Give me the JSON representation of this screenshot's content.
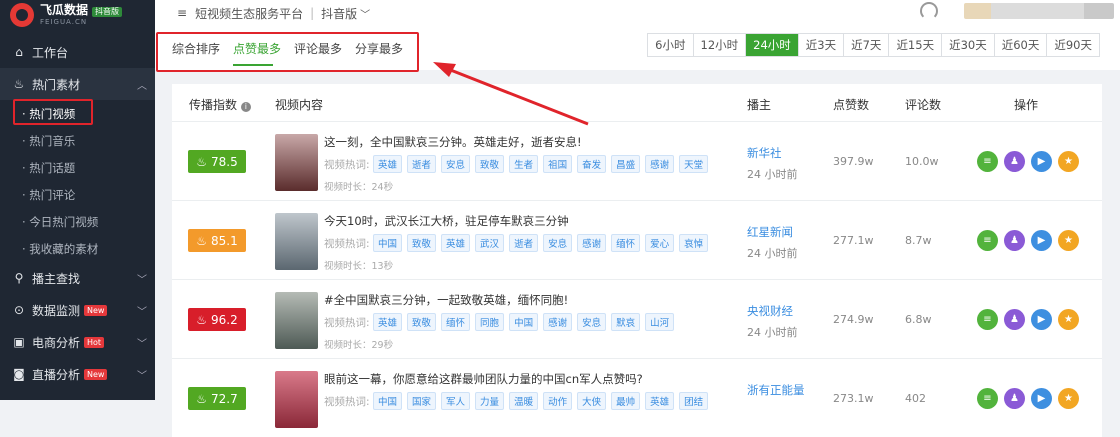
{
  "app": {
    "name": "飞瓜数据",
    "badge": "抖音版",
    "sub": "FEIGUA.CN"
  },
  "header": {
    "platform": "短视频生态服务平台",
    "edition": "抖音版"
  },
  "sidebar": {
    "items": [
      {
        "label": "工作台",
        "icon": "home-icon"
      },
      {
        "label": "热门素材",
        "icon": "fire-icon"
      },
      {
        "label": "播主查找",
        "icon": "search-icon"
      },
      {
        "label": "数据监测",
        "icon": "monitor-icon",
        "badge": "New"
      },
      {
        "label": "电商分析",
        "icon": "cart-icon",
        "badge": "Hot"
      },
      {
        "label": "直播分析",
        "icon": "live-icon",
        "badge": "New"
      }
    ],
    "subitems": [
      "· 热门视频",
      "· 热门音乐",
      "· 热门话题",
      "· 热门评论",
      "· 今日热门视频",
      "· 我收藏的素材"
    ]
  },
  "tabs": [
    "综合排序",
    "点赞最多",
    "评论最多",
    "分享最多"
  ],
  "time_filters": [
    "6小时",
    "12小时",
    "24小时",
    "近3天",
    "近7天",
    "近15天",
    "近30天",
    "近60天",
    "近90天"
  ],
  "table": {
    "headers": [
      "传播指数",
      "视频内容",
      "播主",
      "点赞数",
      "评论数",
      "操作"
    ],
    "hot_label": "视频热词:",
    "rows": [
      {
        "score": "78.5",
        "score_color": "#52a822",
        "title": "这一刻，全中国默哀三分钟。英雄走好，逝者安息!",
        "tags": [
          "英雄",
          "逝者",
          "安息",
          "致敬",
          "生者",
          "祖国",
          "奋发",
          "昌盛",
          "感谢",
          "天堂"
        ],
        "duration": "视频时长：24秒",
        "author": "新华社",
        "time": "24 小时前",
        "likes": "397.9w",
        "comments": "10.0w"
      },
      {
        "score": "85.1",
        "score_color": "#f39a2b",
        "title": "今天10时，武汉长江大桥，驻足停车默哀三分钟",
        "tags": [
          "中国",
          "致敬",
          "英雄",
          "武汉",
          "逝者",
          "安息",
          "感谢",
          "缅怀",
          "爱心",
          "哀悼"
        ],
        "duration": "视频时长：13秒",
        "author": "红星新闻",
        "time": "24 小时前",
        "likes": "277.1w",
        "comments": "8.7w"
      },
      {
        "score": "96.2",
        "score_color": "#d81e2a",
        "title": "#全中国默哀三分钟，一起致敬英雄，缅怀同胞!",
        "tags": [
          "英雄",
          "致敬",
          "缅怀",
          "同胞",
          "中国",
          "感谢",
          "安息",
          "默哀",
          "山河"
        ],
        "duration": "视频时长：29秒",
        "author": "央视财经",
        "time": "24 小时前",
        "likes": "274.9w",
        "comments": "6.8w"
      },
      {
        "score": "72.7",
        "score_color": "#52a822",
        "title": "眼前这一幕，你愿意给这群最帅团队力量的中国cn军人点赞吗?",
        "tags": [
          "中国",
          "国家",
          "军人",
          "力量",
          "温暖",
          "动作",
          "大侠",
          "最帅",
          "英雄",
          "团结"
        ],
        "duration": "",
        "author": "浙有正能量",
        "time": "",
        "likes": "273.1w",
        "comments": "402"
      }
    ]
  },
  "ops_icons": [
    "list-icon",
    "users-icon",
    "play-icon",
    "star-icon"
  ]
}
